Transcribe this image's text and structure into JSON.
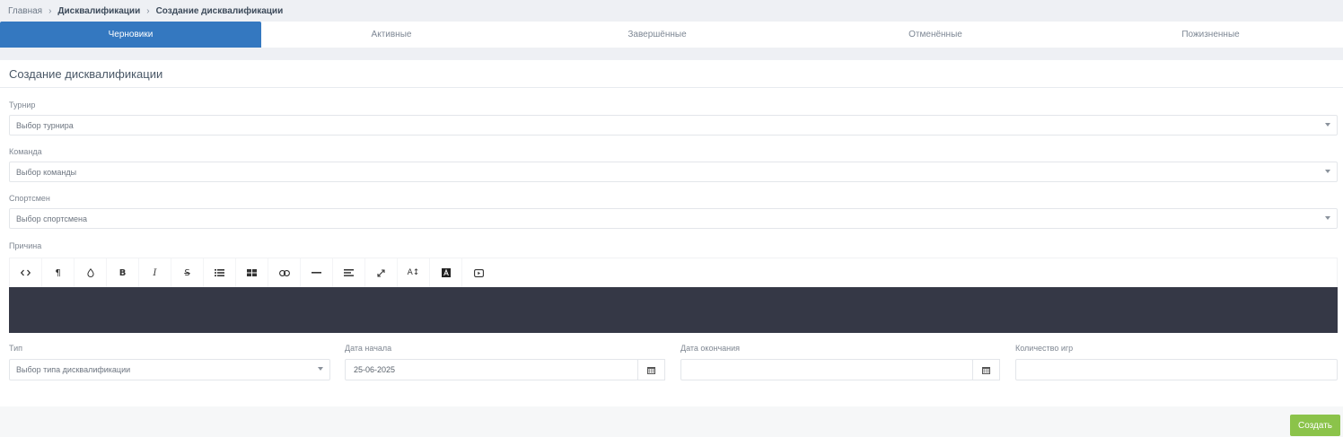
{
  "breadcrumb": {
    "home": "Главная",
    "section": "Дисквалификации",
    "current": "Создание дисквалификации"
  },
  "tabs": [
    {
      "label": "Черновики",
      "active": true
    },
    {
      "label": "Активные",
      "active": false
    },
    {
      "label": "Завершённые",
      "active": false
    },
    {
      "label": "Отменённые",
      "active": false
    },
    {
      "label": "Пожизненные",
      "active": false
    }
  ],
  "form": {
    "title": "Создание дисквалификации",
    "tournament": {
      "label": "Турнир",
      "placeholder": "Выбор турнира"
    },
    "team": {
      "label": "Команда",
      "placeholder": "Выбор команды"
    },
    "athlete": {
      "label": "Спортсмен",
      "placeholder": "Выбор спортсмена"
    },
    "reason": {
      "label": "Причина",
      "value": ""
    },
    "type": {
      "label": "Тип",
      "placeholder": "Выбор типа дисквалификации"
    },
    "start_date": {
      "label": "Дата начала",
      "value": "25-06-2025"
    },
    "end_date": {
      "label": "Дата окончания",
      "value": ""
    },
    "games_count": {
      "label": "Количество игр",
      "value": ""
    }
  },
  "toolbar": [
    "code-view-icon",
    "paragraph-icon",
    "color-drop-icon",
    "bold-icon",
    "italic-icon",
    "strikethrough-icon",
    "bullet-list-icon",
    "table-icon",
    "link-icon",
    "horizontal-rule-icon",
    "align-icon",
    "fullscreen-icon",
    "font-size-icon",
    "text-color-icon",
    "video-icon"
  ],
  "actions": {
    "create_label": "Создать"
  },
  "colors": {
    "accent": "#3478c0",
    "editor_bg": "#353846",
    "success": "#8bc34a",
    "page_bg": "#eef0f4"
  }
}
